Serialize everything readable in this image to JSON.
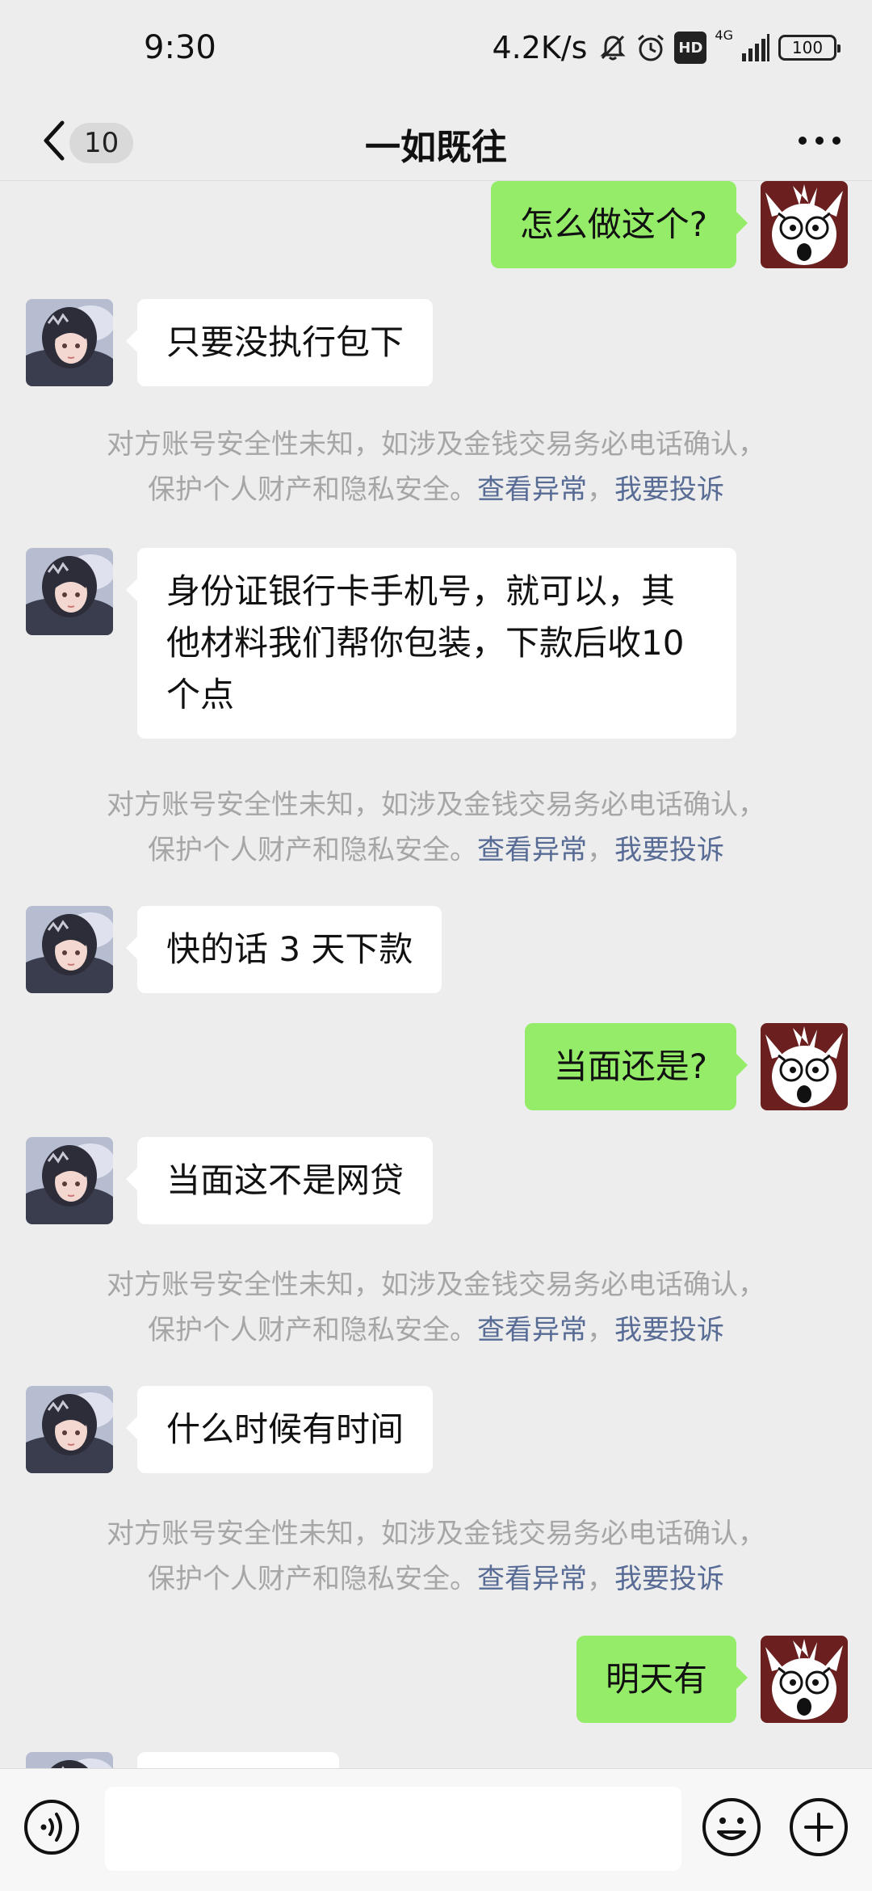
{
  "status_bar": {
    "time": "9:30",
    "net_speed": "4.2K/s",
    "hd_badge": "HD",
    "network": "4G",
    "battery": "100"
  },
  "header": {
    "back_icon": "chevron-left-icon",
    "unread_count": "10",
    "title": "一如既往",
    "more_icon": "ellipsis-icon"
  },
  "messages": [
    {
      "side": "right",
      "text": "怎么做这个?"
    },
    {
      "side": "left",
      "text": "只要没执行包下"
    },
    {
      "side": "left",
      "text": "身份证银行卡手机号，就可以，其他材料我们帮你包装，下款后收10个点"
    },
    {
      "side": "left",
      "text": "快的话 3 天下款"
    },
    {
      "side": "right",
      "text": "当面还是?"
    },
    {
      "side": "left",
      "text": "当面这不是网贷"
    },
    {
      "side": "left",
      "text": "什么时候有时间"
    },
    {
      "side": "right",
      "text": "明天有"
    }
  ],
  "notice": {
    "line1": "对方账号安全性未知，如涉及金钱交易务必电话确认，",
    "line2": "保护个人财产和隐私安全。",
    "link1": "查看异常",
    "sep": "，",
    "link2": "我要投诉"
  },
  "input_bar": {
    "voice_icon": "voice-icon",
    "input_value": "",
    "emoji_icon": "emoji-icon",
    "plus_icon": "plus-icon"
  },
  "colors": {
    "background": "#ededed",
    "bubble_sent": "#95ec69",
    "bubble_received": "#ffffff",
    "notice_text": "#a6a6a6",
    "link": "#576b95"
  }
}
